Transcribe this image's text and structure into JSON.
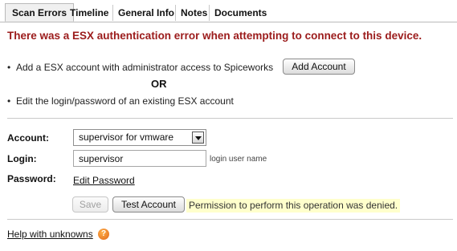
{
  "tabs": [
    {
      "label": "Scan Errors",
      "active": true
    },
    {
      "label": "Timeline",
      "active": false
    },
    {
      "label": "General Info",
      "active": false
    },
    {
      "label": "Notes",
      "active": false
    },
    {
      "label": "Documents",
      "active": false
    }
  ],
  "error": {
    "title": "There was a ESX authentication error when attempting to connect to this device."
  },
  "options": {
    "add_text": "Add a ESX account with administrator access to Spiceworks",
    "add_button": "Add Account",
    "or_text": "OR",
    "edit_text": "Edit the login/password of an existing ESX account"
  },
  "form": {
    "account_label": "Account:",
    "account_value": "supervisor for vmware",
    "login_label": "Login:",
    "login_value": "supervisor",
    "login_hint": "login user name",
    "password_label": "Password:",
    "edit_password_link": "Edit Password",
    "save_button": "Save",
    "test_button": "Test Account",
    "status_message": "Permission to perform this operation was denied."
  },
  "footer": {
    "help_link": "Help with unknowns",
    "help_icon_glyph": "?"
  },
  "colors": {
    "error_text": "#9b1b1b",
    "status_highlight": "#ffffcc",
    "help_icon": "#e0671a"
  }
}
